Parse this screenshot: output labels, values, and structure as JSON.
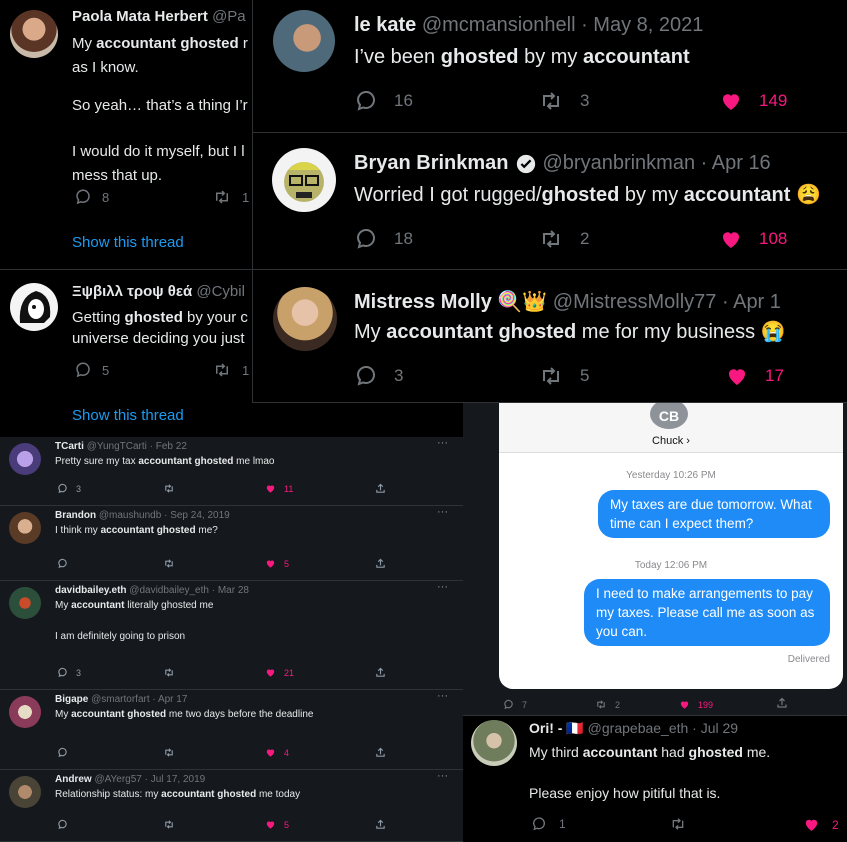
{
  "paola": {
    "name": "Paola Mata Herbert",
    "handle": "@Pa",
    "line1_pre": "My ",
    "line1_bold": "accountant ghosted",
    "line1_post": " r",
    "line2": "as I know.",
    "line3": "So yeah… that’s a thing I’r",
    "line4": "I would do it myself, but I l",
    "line5": "mess that up.",
    "replies": "8",
    "retweets": "1",
    "show_thread": "Show this thread"
  },
  "cybil": {
    "name": "Ξψβιλλ τροψ θεά",
    "handle": "@Cybil",
    "line1_pre": "Getting ",
    "line1_bold": "ghosted",
    "line1_post": " by your c",
    "line2": "universe deciding you just",
    "replies": "5",
    "retweets": "1",
    "show_thread": "Show this thread"
  },
  "lekate": {
    "name": "le kate",
    "handle": "@mcmansionhell · May 8, 2021",
    "t_pre": "I’ve been ",
    "t_b1": "ghosted",
    "t_mid": " by my ",
    "t_b2": "accountant",
    "replies": "16",
    "retweets": "3",
    "likes": "149"
  },
  "bryan": {
    "name": "Bryan Brinkman",
    "handle": "@bryanbrinkman · Apr 16",
    "t_pre": "Worried I got rugged/",
    "t_b1": "ghosted",
    "t_mid": " by my ",
    "t_b2": "accountant",
    "emoji": "😩",
    "replies": "18",
    "retweets": "2",
    "likes": "108"
  },
  "molly": {
    "name": "Mistress Molly",
    "emojis": "🍭👑",
    "handle": "@MistressMolly77 · Apr 1",
    "t_pre": "My ",
    "t_b1": "accountant ghosted",
    "t_post": " me for my business",
    "emoji": "😭",
    "replies": "3",
    "retweets": "5",
    "likes": "17"
  },
  "small": [
    {
      "name": "TCarti",
      "meta": "@YungTCarti · Feb 22",
      "pre": "Pretty sure my tax ",
      "bold": "accountant ghosted",
      "post": " me lmao",
      "line2": "",
      "replies": "3",
      "likes": "11"
    },
    {
      "name": "Brandon",
      "meta": "@maushundb · Sep 24, 2019",
      "pre": "I think my ",
      "bold": "accountant ghosted",
      "post": " me?",
      "line2": "",
      "replies": "",
      "likes": "5"
    },
    {
      "name": "davidbailey.eth",
      "meta": "@davidbailey_eth · Mar 28",
      "pre": "My ",
      "bold": "accountant",
      "post": " literally ghosted me",
      "line2": "I am definitely going to prison",
      "replies": "3",
      "likes": "21"
    },
    {
      "name": "Bigape",
      "meta": "@smartorfart · Apr 17",
      "pre": "My ",
      "bold": "accountant ghosted",
      "post": " me two days before the deadline",
      "line2": "",
      "replies": "",
      "likes": "4"
    },
    {
      "name": "Andrew",
      "meta": "@AYerg57 · Jul 17, 2019",
      "pre": "Relationship status: my ",
      "bold": "accountant ghosted",
      "post": " me today",
      "line2": "",
      "replies": "",
      "likes": "5"
    }
  ],
  "imessage": {
    "initials": "CB",
    "contact": "Chuck ›",
    "time1": "Yesterday 10:26 PM",
    "msg1": "My taxes are due tomorrow. What time can I expect them?",
    "time2": "Today 12:06 PM",
    "msg2": "I need to make arrangements to pay my taxes. Please call me as soon as you can.",
    "delivered": "Delivered",
    "replies": "7",
    "retweets": "2",
    "likes": "199"
  },
  "ori": {
    "name": "Ori! -",
    "flag": "🇫🇷",
    "handle": "@grapebae_eth · Jul 29",
    "t_pre": "My third ",
    "t_b1": "accountant",
    "t_mid": " had ",
    "t_b2": "ghosted",
    "t_post": " me.",
    "line2": "Please enjoy how pitiful that is.",
    "replies": "1",
    "likes": "2"
  },
  "colors": {
    "accent": "#1d9bf0",
    "like": "#f91880",
    "bubble": "#1f8bf6"
  }
}
